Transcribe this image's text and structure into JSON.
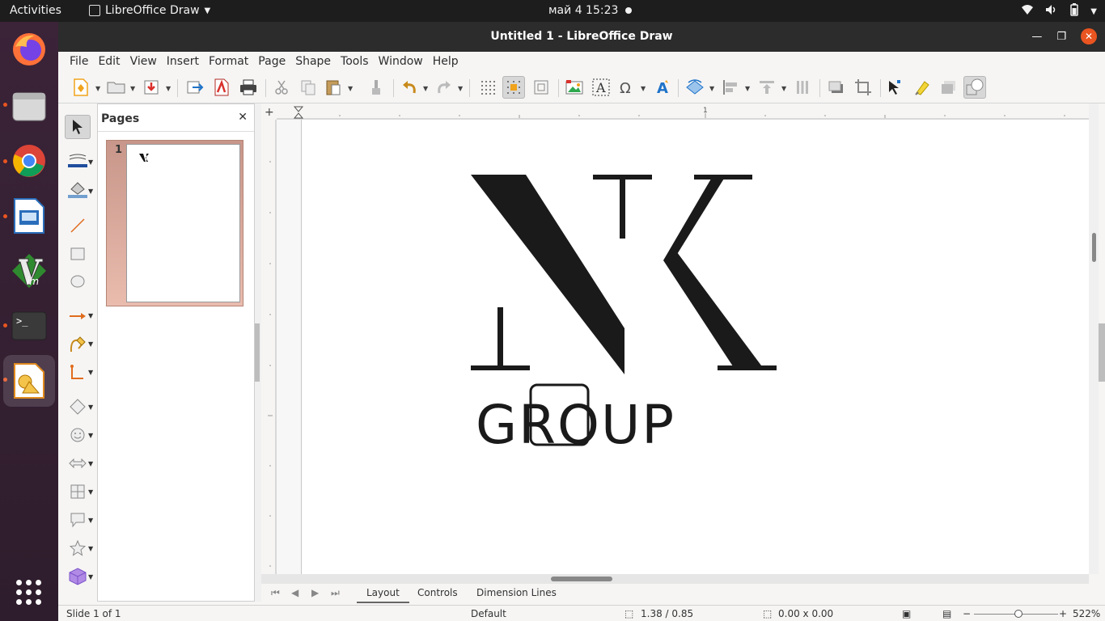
{
  "topbar": {
    "activities": "Activities",
    "app_name": "LibreOffice Draw",
    "clock": "май 4  15:23"
  },
  "window": {
    "title": "Untitled 1 - LibreOffice Draw"
  },
  "menu": [
    "File",
    "Edit",
    "View",
    "Insert",
    "Format",
    "Page",
    "Shape",
    "Tools",
    "Window",
    "Help"
  ],
  "pages_panel": {
    "title": "Pages",
    "page_number": "1"
  },
  "canvas": {
    "logo_text": "GROUP",
    "accent_color": "#1a1a1a"
  },
  "tabs": {
    "layout": "Layout",
    "controls": "Controls",
    "dimension_lines": "Dimension Lines"
  },
  "status": {
    "slide": "Slide 1 of 1",
    "master": "Default",
    "position": "1.38 / 0.85",
    "size": "0.00 x 0.00",
    "zoom": "522%"
  },
  "dock": [
    "firefox-icon",
    "files-icon",
    "chrome-icon",
    "impress-icon",
    "vim-icon",
    "terminal-icon",
    "draw-icon"
  ]
}
